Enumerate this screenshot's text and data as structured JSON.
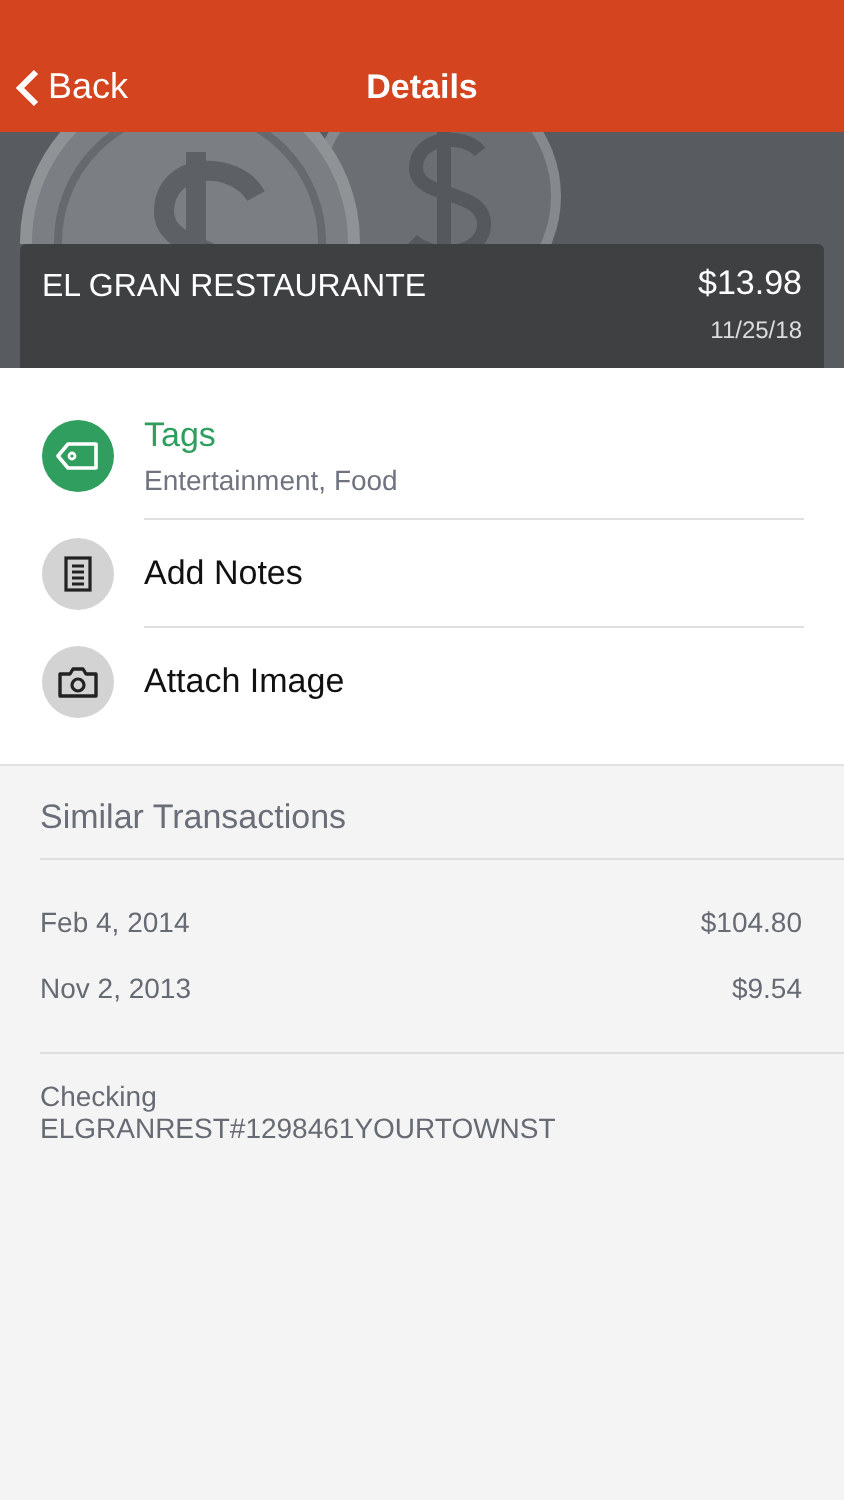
{
  "nav": {
    "back": "Back",
    "title": "Details"
  },
  "summary": {
    "merchant": "EL GRAN RESTAURANTE",
    "amount": "$13.98",
    "date": "11/25/18"
  },
  "actions": [
    {
      "kind": "tags",
      "label": "Tags",
      "detail": "Entertainment, Food"
    },
    {
      "kind": "notes",
      "label": "Add Notes"
    },
    {
      "kind": "image",
      "label": "Attach Image"
    }
  ],
  "similar": {
    "title": "Similar Transactions",
    "rows": [
      {
        "date": "Feb 4, 2014",
        "amount": "$104.80"
      },
      {
        "date": "Nov 2, 2013",
        "amount": "$9.54"
      }
    ]
  },
  "account": {
    "name": "Checking",
    "description": "ELGRANREST#1298461YOURTOWNST"
  }
}
